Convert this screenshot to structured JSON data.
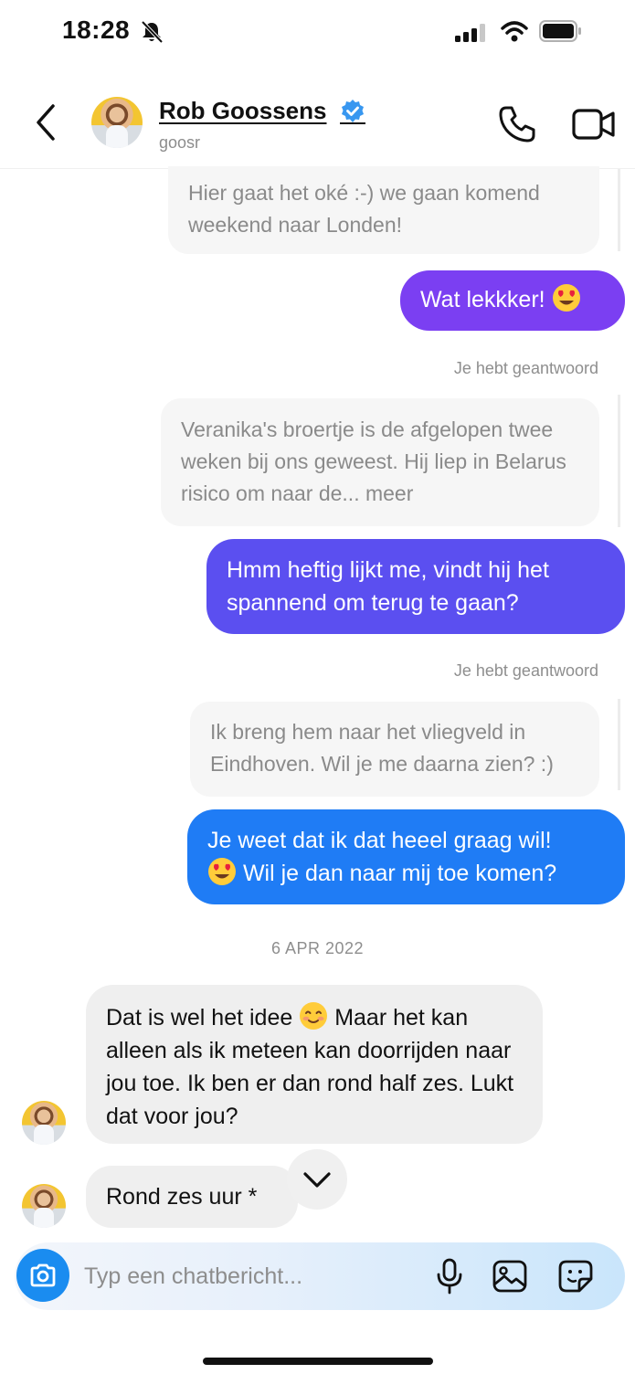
{
  "status_bar": {
    "time": "18:28",
    "icons": [
      "bell-slash-icon",
      "signal-icon",
      "wifi-icon",
      "battery-icon"
    ]
  },
  "header": {
    "contact_name": "Rob Goossens",
    "username": "goosr",
    "verified": true,
    "icons": [
      "back-icon",
      "phone-icon",
      "video-icon"
    ],
    "verified_color": "#3897f0"
  },
  "messages": [
    {
      "type": "received-dim",
      "text": "Hier gaat het oké :-) we gaan komend weekend naar Londen!"
    },
    {
      "type": "sent",
      "text": "Wat lekkker!",
      "emoji": "heart-eyes"
    },
    {
      "type": "note",
      "text": "Je hebt geantwoord"
    },
    {
      "type": "received-dim",
      "text": "Veranika's broertje is de afgelopen twee weken bij ons geweest. Hij liep in Belarus risico om naar de... meer"
    },
    {
      "type": "sent",
      "text": "Hmm heftig lijkt me, vindt hij het spannend om terug te gaan?"
    },
    {
      "type": "note",
      "text": "Je hebt geantwoord"
    },
    {
      "type": "received-dim",
      "text": "Ik breng hem naar het vliegveld in Eindhoven. Wil je me daarna zien? :)"
    },
    {
      "type": "sent",
      "line1": "Je weet dat ik dat heeel graag wil!",
      "line2": "Wil je dan naar mij toe komen?",
      "emoji": "heart-eyes"
    },
    {
      "type": "date",
      "text": "6 APR 2022"
    },
    {
      "type": "received",
      "part1": "Dat is wel het idee",
      "emoji": "smiling-blush",
      "part2": "Maar het kan alleen als ik meteen kan doorrijden naar jou toe. Ik ben er dan rond half zes. Lukt dat voor jou?"
    },
    {
      "type": "received",
      "text": "Rond zes uur *"
    }
  ],
  "colors": {
    "sent_purple": "#7b3ff2",
    "sent_indigo": "#5b4ff0",
    "sent_blue": "#1f7cf5",
    "received_bg": "#efefef",
    "accent": "#1a8cf0"
  },
  "composer": {
    "placeholder": "Typ een chatbericht...",
    "icons": [
      "camera-icon",
      "microphone-icon",
      "gallery-icon",
      "sticker-icon"
    ]
  }
}
